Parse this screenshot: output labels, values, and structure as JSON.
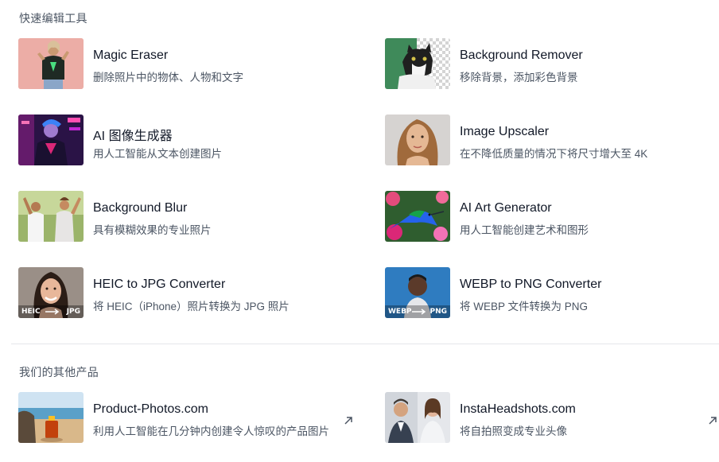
{
  "quick_tools": {
    "title": "快速编辑工具",
    "items": [
      {
        "title": "Magic Eraser",
        "desc": "删除照片中的物体、人物和文字",
        "thumb": "woman-pink-wall-image"
      },
      {
        "title": "Background Remover",
        "desc": "移除背景，添加彩色背景",
        "thumb": "cat-transparent-image"
      },
      {
        "title": "AI 图像生成器",
        "desc": "用人工智能从文本创建图片",
        "thumb": "neon-character-image"
      },
      {
        "title": "Image Upscaler",
        "desc": "在不降低质量的情况下将尺寸增大至 4K",
        "thumb": "portrait-woman-image"
      },
      {
        "title": "Background Blur",
        "desc": "具有模糊效果的专业照片",
        "thumb": "dancing-women-image"
      },
      {
        "title": "AI Art Generator",
        "desc": "用人工智能创建艺术和图形",
        "thumb": "hummingbird-art-image"
      },
      {
        "title": "HEIC to JPG Converter",
        "desc": "将 HEIC（iPhone）照片转换为 JPG 照片",
        "thumb": "woman-smiling-image",
        "badge_left": "HEIC",
        "badge_right": "JPG"
      },
      {
        "title": "WEBP to PNG Converter",
        "desc": "将 WEBP 文件转换为 PNG",
        "thumb": "woman-blue-bg-image",
        "badge_left": "WEBP",
        "badge_right": "PNG"
      }
    ]
  },
  "other_products": {
    "title": "我们的其他产品",
    "items": [
      {
        "title": "Product-Photos.com",
        "desc": "利用人工智能在几分钟内创建令人惊叹的产品图片",
        "thumb": "perfume-beach-image"
      },
      {
        "title": "InstaHeadshots.com",
        "desc": "将自拍照变成专业头像",
        "thumb": "headshots-pair-image"
      }
    ]
  }
}
